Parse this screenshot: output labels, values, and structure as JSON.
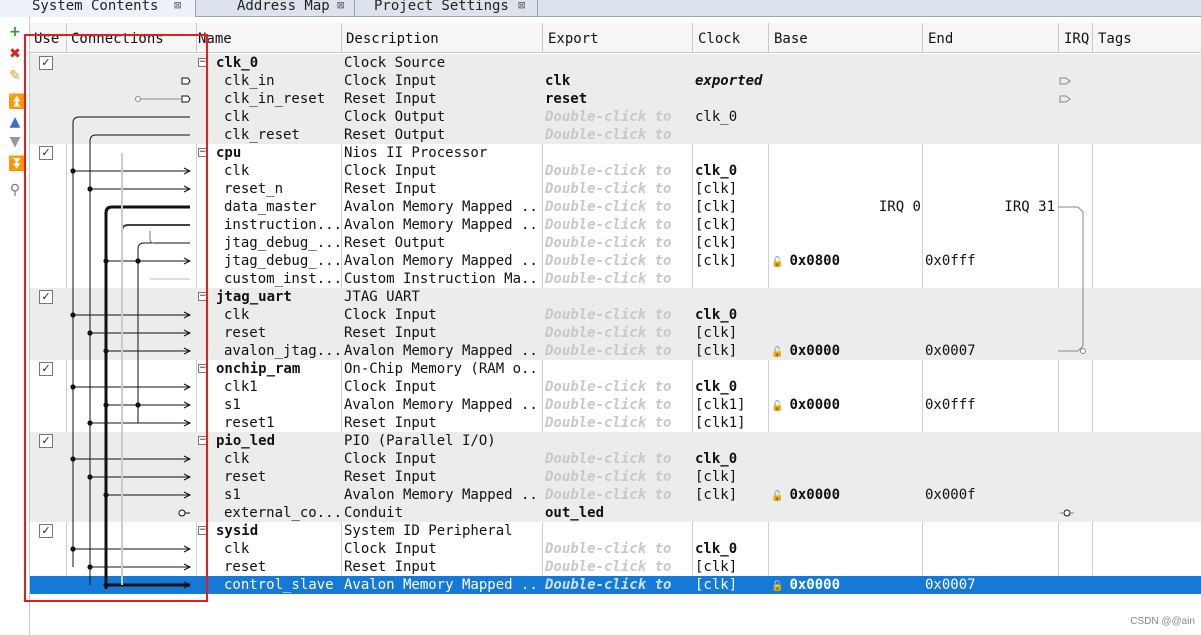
{
  "tabs": [
    {
      "label": "System Contents",
      "active": true
    },
    {
      "label": "Address Map",
      "active": false
    },
    {
      "label": "Project Settings",
      "active": false
    }
  ],
  "toolbar": {
    "icons": [
      "add-icon",
      "remove-icon",
      "edit-icon",
      "move-top-icon",
      "move-up-icon",
      "move-down-icon",
      "move-bottom-icon",
      "filter-icon"
    ]
  },
  "headers": {
    "use": "Use",
    "connections": "Connections",
    "name": "Name",
    "description": "Description",
    "export": "Export",
    "clock": "Clock",
    "base": "Base",
    "end": "End",
    "irq": "IRQ",
    "tags": "Tags"
  },
  "placeholder": "Double-click to",
  "rows": [
    {
      "type": "comp",
      "name": "clk_0",
      "desc": "Clock Source",
      "export": "",
      "clock": "",
      "base": "",
      "end": "",
      "irq": ""
    },
    {
      "type": "port",
      "name": "clk_in",
      "desc": "Clock Input",
      "export": "clk",
      "export_style": "b",
      "clock": "exported",
      "clock_style": "bi",
      "base": "",
      "end": "",
      "irq": ""
    },
    {
      "type": "port",
      "name": "clk_in_reset",
      "desc": "Reset Input",
      "export": "reset",
      "export_style": "b",
      "clock": "",
      "base": "",
      "end": "",
      "irq": ""
    },
    {
      "type": "port",
      "name": "clk",
      "desc": "Clock Output",
      "export": "",
      "ph": true,
      "clock": "clk_0",
      "base": "",
      "end": "",
      "irq": ""
    },
    {
      "type": "port",
      "name": "clk_reset",
      "desc": "Reset Output",
      "export": "",
      "ph": true,
      "clock": "",
      "base": "",
      "end": "",
      "irq": ""
    },
    {
      "type": "comp",
      "name": "cpu",
      "desc": "Nios II Processor",
      "export": "",
      "clock": "",
      "base": "",
      "end": "",
      "irq": ""
    },
    {
      "type": "port",
      "name": "clk",
      "desc": "Clock Input",
      "export": "",
      "ph": true,
      "clock": "clk_0",
      "clock_style": "b",
      "base": "",
      "end": "",
      "irq": ""
    },
    {
      "type": "port",
      "name": "reset_n",
      "desc": "Reset Input",
      "export": "",
      "ph": true,
      "clock": "[clk]",
      "base": "",
      "end": "",
      "irq": ""
    },
    {
      "type": "port",
      "name": "data_master",
      "desc": "Avalon Memory Mapped ...",
      "export": "",
      "ph": true,
      "clock": "[clk]",
      "base": "IRQ 0",
      "end": "IRQ 31",
      "irq": ""
    },
    {
      "type": "port",
      "name": "instruction...",
      "desc": "Avalon Memory Mapped ...",
      "export": "",
      "ph": true,
      "clock": "[clk]",
      "base": "",
      "end": "",
      "irq": ""
    },
    {
      "type": "port",
      "name": "jtag_debug_...",
      "desc": "Reset Output",
      "export": "",
      "ph": true,
      "clock": "[clk]",
      "base": "",
      "end": "",
      "irq": ""
    },
    {
      "type": "port",
      "name": "jtag_debug_...",
      "desc": "Avalon Memory Mapped ...",
      "export": "",
      "ph": true,
      "clock": "[clk]",
      "base": "0x0800",
      "lock": true,
      "end": "0x0fff",
      "irq": ""
    },
    {
      "type": "port",
      "name": "custom_inst...",
      "desc": "Custom Instruction Ma...",
      "export": "",
      "ph": true,
      "clock": "",
      "base": "",
      "end": "",
      "irq": ""
    },
    {
      "type": "comp",
      "name": "jtag_uart",
      "desc": "JTAG UART",
      "export": "",
      "clock": "",
      "base": "",
      "end": "",
      "irq": ""
    },
    {
      "type": "port",
      "name": "clk",
      "desc": "Clock Input",
      "export": "",
      "ph": true,
      "clock": "clk_0",
      "clock_style": "b",
      "base": "",
      "end": "",
      "irq": ""
    },
    {
      "type": "port",
      "name": "reset",
      "desc": "Reset Input",
      "export": "",
      "ph": true,
      "clock": "[clk]",
      "base": "",
      "end": "",
      "irq": ""
    },
    {
      "type": "port",
      "name": "avalon_jtag...",
      "desc": "Avalon Memory Mapped ...",
      "export": "",
      "ph": true,
      "clock": "[clk]",
      "base": "0x0000",
      "lock": true,
      "end": "0x0007",
      "irq": ""
    },
    {
      "type": "comp",
      "name": "onchip_ram",
      "desc": "On-Chip Memory (RAM o...",
      "export": "",
      "clock": "",
      "base": "",
      "end": "",
      "irq": ""
    },
    {
      "type": "port",
      "name": "clk1",
      "desc": "Clock Input",
      "export": "",
      "ph": true,
      "clock": "clk_0",
      "clock_style": "b",
      "base": "",
      "end": "",
      "irq": ""
    },
    {
      "type": "port",
      "name": "s1",
      "desc": "Avalon Memory Mapped ...",
      "export": "",
      "ph": true,
      "clock": "[clk1]",
      "base": "0x0000",
      "lock": true,
      "end": "0x0fff",
      "irq": ""
    },
    {
      "type": "port",
      "name": "reset1",
      "desc": "Reset Input",
      "export": "",
      "ph": true,
      "clock": "[clk1]",
      "base": "",
      "end": "",
      "irq": ""
    },
    {
      "type": "comp",
      "name": "pio_led",
      "desc": "PIO (Parallel I/O)",
      "export": "",
      "clock": "",
      "base": "",
      "end": "",
      "irq": ""
    },
    {
      "type": "port",
      "name": "clk",
      "desc": "Clock Input",
      "export": "",
      "ph": true,
      "clock": "clk_0",
      "clock_style": "b",
      "base": "",
      "end": "",
      "irq": ""
    },
    {
      "type": "port",
      "name": "reset",
      "desc": "Reset Input",
      "export": "",
      "ph": true,
      "clock": "[clk]",
      "base": "",
      "end": "",
      "irq": ""
    },
    {
      "type": "port",
      "name": "s1",
      "desc": "Avalon Memory Mapped ...",
      "export": "",
      "ph": true,
      "clock": "[clk]",
      "base": "0x0000",
      "lock": true,
      "end": "0x000f",
      "irq": ""
    },
    {
      "type": "port",
      "name": "external_co...",
      "desc": "Conduit",
      "export": "out_led",
      "export_style": "b",
      "clock": "",
      "base": "",
      "end": "",
      "irq": ""
    },
    {
      "type": "comp",
      "name": "sysid",
      "desc": "System ID Peripheral",
      "export": "",
      "clock": "",
      "base": "",
      "end": "",
      "irq": ""
    },
    {
      "type": "port",
      "name": "clk",
      "desc": "Clock Input",
      "export": "",
      "ph": true,
      "clock": "clk_0",
      "clock_style": "b",
      "base": "",
      "end": "",
      "irq": ""
    },
    {
      "type": "port",
      "name": "reset",
      "desc": "Reset Input",
      "export": "",
      "ph": true,
      "clock": "[clk]",
      "base": "",
      "end": "",
      "irq": ""
    },
    {
      "type": "port",
      "name": "control_slave",
      "desc": "Avalon Memory Mapped ...",
      "export": "",
      "ph": true,
      "clock": "[clk]",
      "base": "0x0000",
      "lock": true,
      "end": "0x0007",
      "irq": "",
      "selected": true
    }
  ],
  "colors": {
    "selection": "#1479d7",
    "group_gray": "#ececec",
    "highlight_box": "#e02020"
  },
  "watermark": "CSDN @@ain"
}
